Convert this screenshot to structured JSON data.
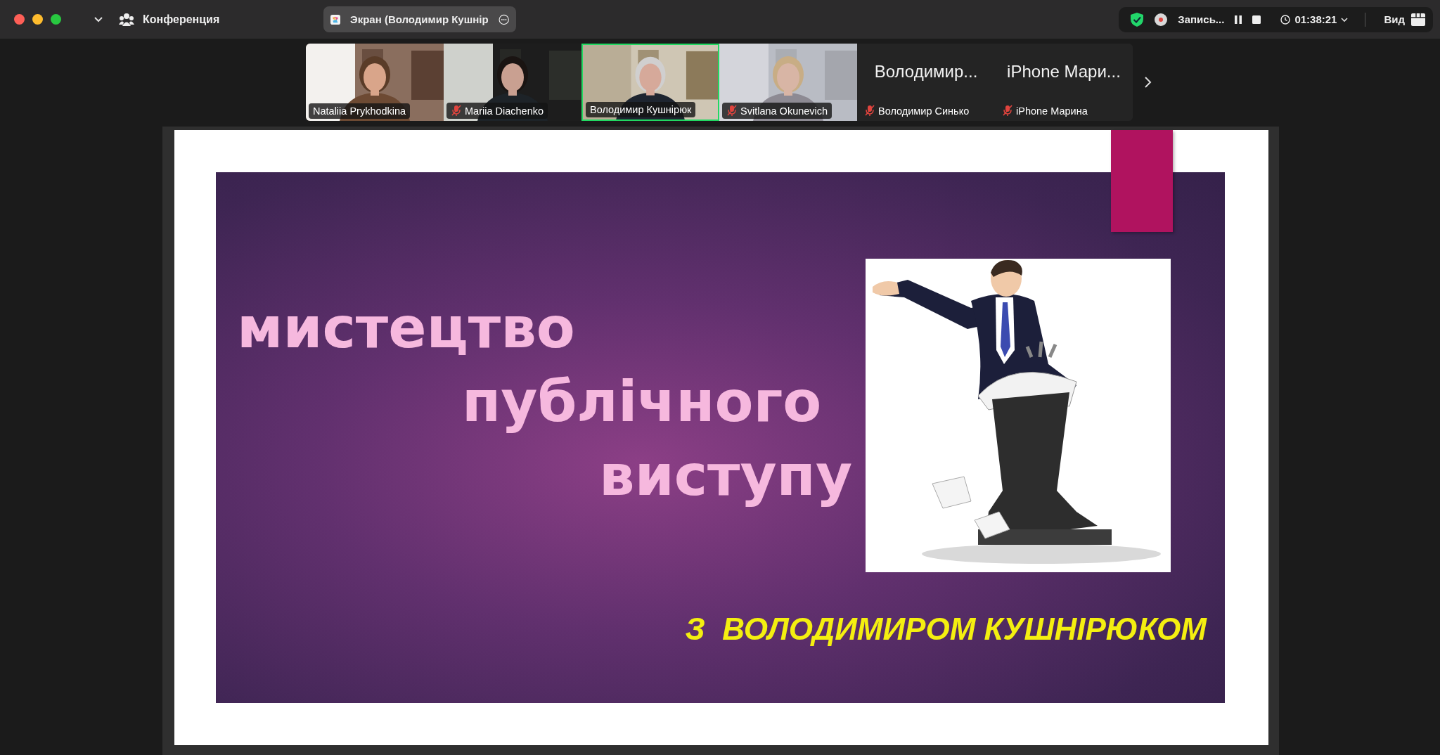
{
  "top_bar": {
    "window_controls": [
      {
        "kind": "close"
      },
      {
        "kind": "minimize"
      },
      {
        "kind": "zoom"
      }
    ],
    "meeting_title": "Конференция",
    "share_tab": {
      "label": "Экран (Володимир Кушнір"
    },
    "recording": {
      "label": "Запись..."
    },
    "timer": "01:38:21",
    "view": "Вид"
  },
  "participants": [
    {
      "kind": "video",
      "name": "Nataliia Prykhodkina",
      "muted": false,
      "selected": false
    },
    {
      "kind": "video",
      "name": "Mariia Diachenko",
      "muted": true,
      "selected": false
    },
    {
      "kind": "video",
      "name": "Володимир Кушнірюк",
      "muted": false,
      "selected": true
    },
    {
      "kind": "video",
      "name": "Svitlana Okunevich",
      "muted": true,
      "selected": false
    },
    {
      "kind": "name",
      "display_name": "Володимир...",
      "name": "Володимир Синько",
      "muted": true,
      "selected": false
    },
    {
      "kind": "name",
      "display_name": "iPhone Мари...",
      "name": "iPhone Марина",
      "muted": true,
      "selected": false
    }
  ],
  "slide": {
    "title_lines": [
      "мистецтво",
      "публічного",
      "виступу"
    ],
    "subtitle": "З  ВОЛОДИМИРОМ КУШНІРЮКОМ"
  }
}
